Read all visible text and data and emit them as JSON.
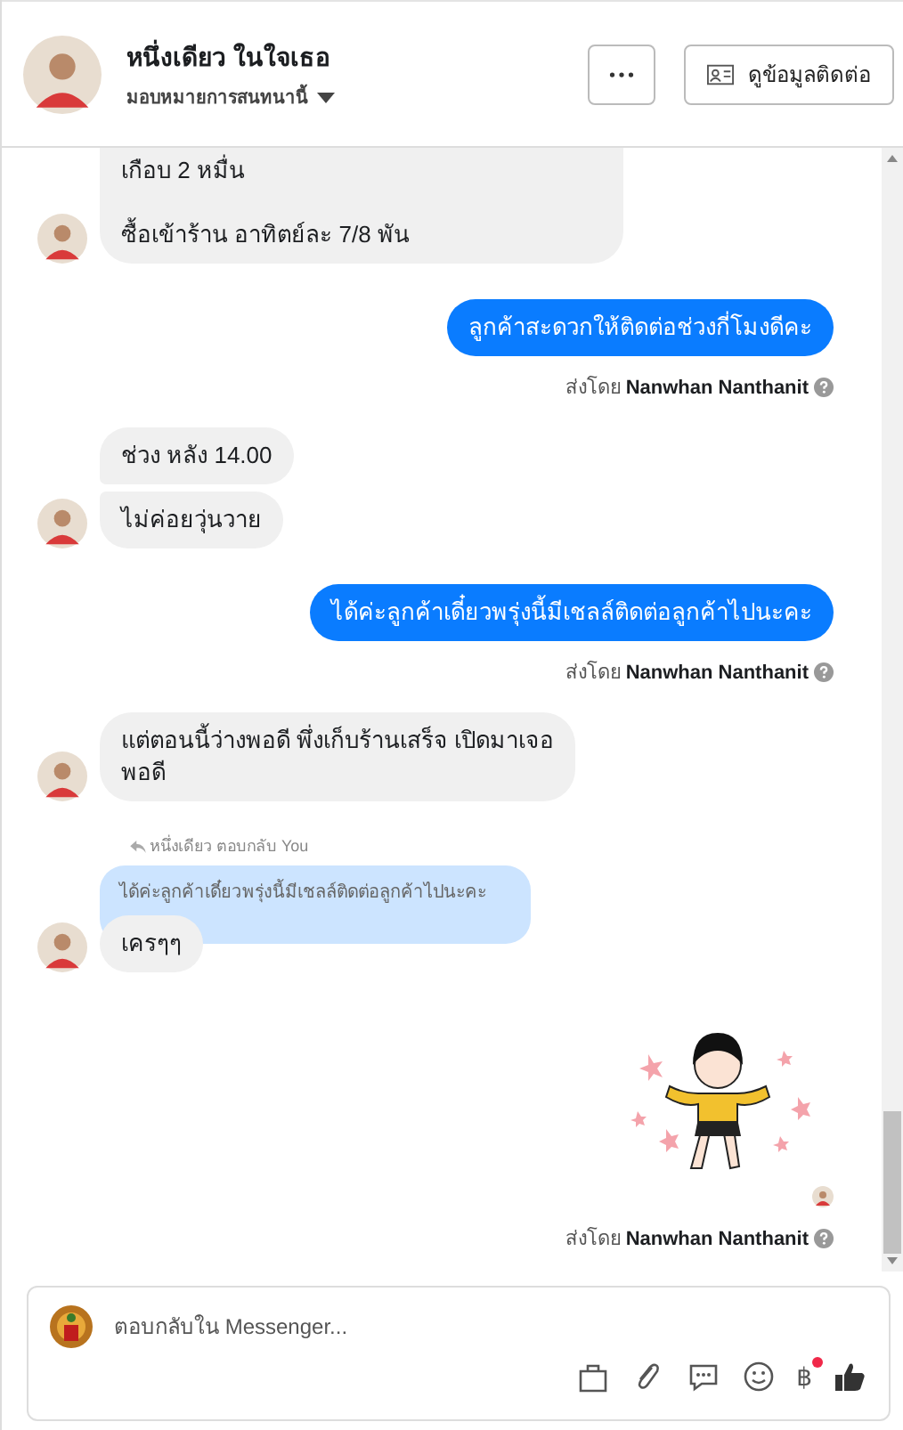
{
  "header": {
    "name": "หนึ่งเดียว ในใจเธอ",
    "subtitle": "มอบหมายการสนทนานี้",
    "contact_button": "ดูข้อมูลติดต่อ"
  },
  "messages": [
    {
      "kind": "incoming",
      "cut_top": true,
      "bubbles": [
        "เกือบ 2 หมื่น\n\nซื้อเข้าร้าน อาทิตย์ละ 7/8 พัน"
      ]
    },
    {
      "kind": "outgoing",
      "bubbles": [
        "ลูกค้าสะดวกให้ติดต่อช่วงกี่โมงดีคะ"
      ],
      "sent_by": "ส่งโดย **Nanwhan Nanthanit**"
    },
    {
      "kind": "incoming",
      "bubbles": [
        "ช่วง หลัง 14.00",
        "ไม่ค่อยวุ่นวาย"
      ]
    },
    {
      "kind": "outgoing",
      "bubbles": [
        "ได้ค่ะลูกค้าเดี๋ยวพรุ่งนี้มีเชลล์ติดต่อลูกค้าไปนะคะ"
      ],
      "sent_by": "ส่งโดย **Nanwhan Nanthanit**"
    },
    {
      "kind": "incoming",
      "bubbles": [
        "แต่ตอนนี้ว่างพอดี พึ่งเก็บร้านเสร็จ เปิดมาเจอ\nพอดี"
      ]
    },
    {
      "kind": "reply",
      "reply_label": "หนึ่งเดียว ตอบกลับ You",
      "quote": "ได้ค่ะลูกค้าเดี๋ยวพรุ่งนี้มีเชลล์ติดต่อลูกค้าไปนะคะ",
      "bubbles": [
        "เครๆๆ"
      ]
    },
    {
      "kind": "sticker",
      "seen": true,
      "sent_by": "ส่งโดย **Nanwhan Nanthanit**"
    }
  ],
  "composer": {
    "placeholder": "ตอบกลับใน Messenger...",
    "currency_symbol": "฿",
    "payment_badge": true
  }
}
